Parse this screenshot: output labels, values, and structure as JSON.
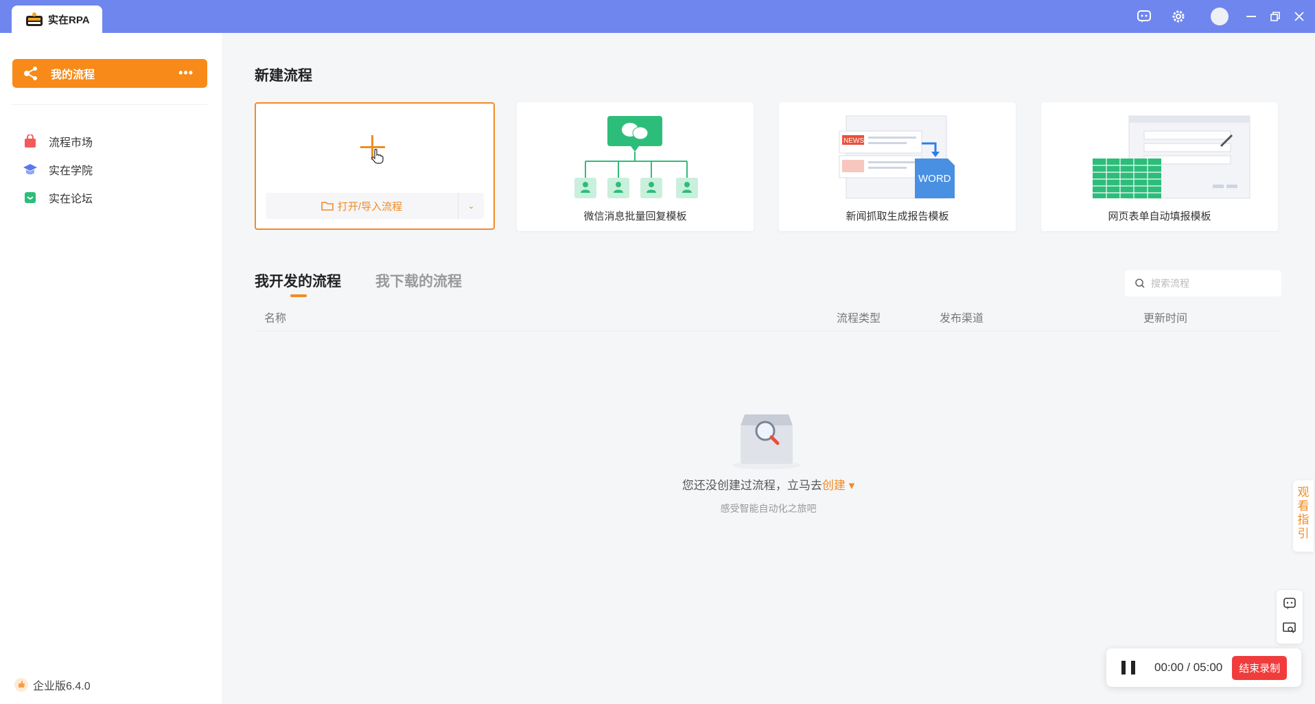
{
  "app": {
    "title": "实在RPA"
  },
  "colors": {
    "titlebar": "#6e86ee",
    "accent": "#f28a23",
    "danger": "#f03c3c"
  },
  "titlebar_icons": [
    "chat-icon",
    "gear-icon",
    "avatar",
    "minimize-icon",
    "restore-icon",
    "close-icon"
  ],
  "sidebar": {
    "primary": {
      "label": "我的流程",
      "more": "•••"
    },
    "items": [
      {
        "label": "流程市场",
        "icon": "bag-icon"
      },
      {
        "label": "实在学院",
        "icon": "graduation-cap-icon"
      },
      {
        "label": "实在论坛",
        "icon": "forum-icon"
      }
    ],
    "version": "企业版6.4.0"
  },
  "main": {
    "new_section_title": "新建流程",
    "open_import_label": "打开/导入流程",
    "templates": [
      {
        "label": "微信消息批量回复模板"
      },
      {
        "label": "新闻抓取生成报告模板"
      },
      {
        "label": "网页表单自动填报模板"
      }
    ],
    "tabs": [
      {
        "label": "我开发的流程",
        "active": true
      },
      {
        "label": "我下载的流程",
        "active": false
      }
    ],
    "search": {
      "placeholder": "搜索流程"
    },
    "table_headers": [
      "名称",
      "流程类型",
      "发布渠道",
      "更新时间"
    ],
    "empty": {
      "message_prefix": "您还没创建过流程，立马去",
      "message_link": "创建",
      "message_arrow": "▾",
      "subtext": "感受智能自动化之旅吧"
    }
  },
  "guide_tab": {
    "label": "观看指引"
  },
  "recorder": {
    "elapsed": "00:00",
    "separator": " / ",
    "total": "05:00",
    "stop_label": "结束录制"
  }
}
